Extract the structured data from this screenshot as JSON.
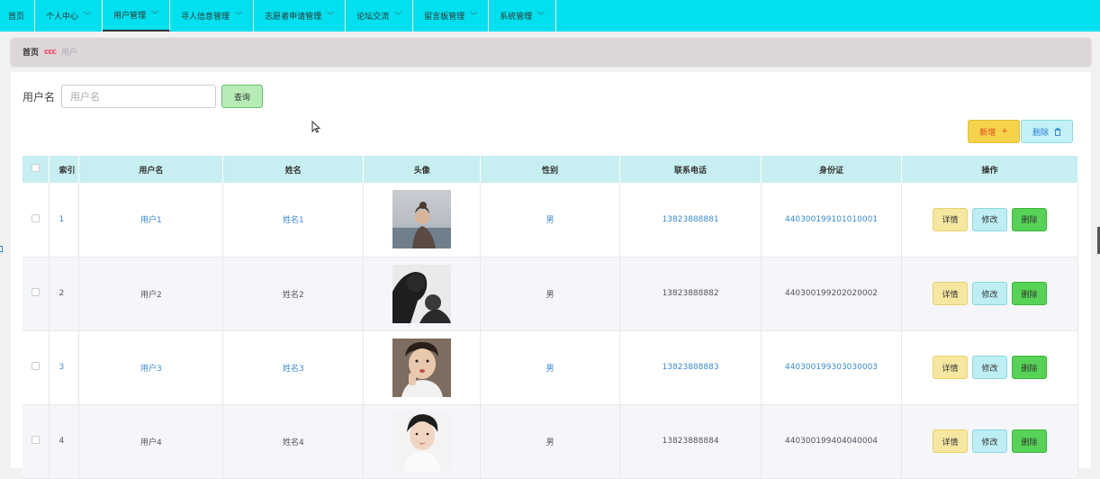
{
  "nav": {
    "items": [
      {
        "label": "首页",
        "has_chevron": false
      },
      {
        "label": "个人中心",
        "has_chevron": true
      },
      {
        "label": "用户管理",
        "has_chevron": true,
        "active": true
      },
      {
        "label": "寻人信息管理",
        "has_chevron": true
      },
      {
        "label": "志愿者申请管理",
        "has_chevron": true
      },
      {
        "label": "论坛交流",
        "has_chevron": true
      },
      {
        "label": "留言板管理",
        "has_chevron": true
      },
      {
        "label": "系统管理",
        "has_chevron": true
      }
    ],
    "chevron": "﹀"
  },
  "breadcrumb": {
    "home": "首页",
    "separator": "ccc",
    "current": "用户"
  },
  "search": {
    "label": "用户名",
    "placeholder": "用户名",
    "button": "查询"
  },
  "toolbar": {
    "add_label": "新增",
    "add_icon": "+",
    "delete_label": "删除",
    "delete_icon": "🗑"
  },
  "table": {
    "headers": [
      "索引",
      "用户名",
      "姓名",
      "头像",
      "性别",
      "联系电话",
      "身份证",
      "操作"
    ],
    "rows": [
      {
        "index": "1",
        "username": "用户1",
        "name": "姓名1",
        "gender": "男",
        "phone": "13823888881",
        "id_card": "440300199101010001"
      },
      {
        "index": "2",
        "username": "用户2",
        "name": "姓名2",
        "gender": "男",
        "phone": "13823888882",
        "id_card": "440300199202020002"
      },
      {
        "index": "3",
        "username": "用户3",
        "name": "姓名3",
        "gender": "男",
        "phone": "13823888883",
        "id_card": "440300199303030003"
      },
      {
        "index": "4",
        "username": "用户4",
        "name": "姓名4",
        "gender": "男",
        "phone": "13823888884",
        "id_card": "440300199404040004"
      }
    ],
    "actions": {
      "detail": "详情",
      "edit": "修改",
      "delete": "删除"
    }
  },
  "colors": {
    "nav_bg": "#00e0ee",
    "header_bg": "#c7eef0",
    "link": "#3b8bd1"
  }
}
